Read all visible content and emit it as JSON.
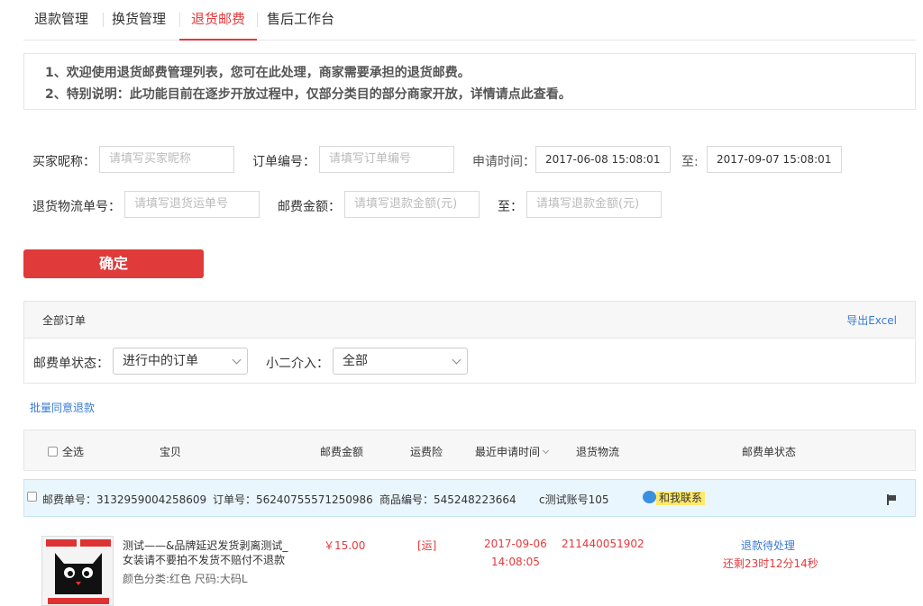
{
  "tabs": [
    "退款管理",
    "换货管理",
    "退货邮费",
    "售后工作台"
  ],
  "notice": [
    "1、欢迎使用退货邮费管理列表，您可在此处理，商家需要承担的退货邮费。",
    "2、特别说明：此功能目前在逐步开放过程中，仅部分类目的部分商家开放，详情请点此查看。"
  ],
  "filters": {
    "buyer_label": "买家昵称：",
    "buyer_placeholder": "请填写买家昵称",
    "order_label": "订单编号：",
    "order_placeholder": "请填写订单编号",
    "time_label": "申请时间：",
    "time_from": "2017-06-08 15:08:01",
    "to_label": "至:",
    "time_to": "2017-09-07 15:08:01",
    "logistics_label": "退货物流单号：",
    "logistics_placeholder": "请填写退货运单号",
    "amount_label": "邮费金额：",
    "amount_placeholder": "请填写退款金额(元)",
    "amount_to_label": "至：",
    "amount_to_placeholder": "请填写退款金额(元)"
  },
  "confirm_label": "确定",
  "panel": {
    "title": "全部订单",
    "export": "导出Excel",
    "status_label": "邮费单状态：",
    "status_value": "进行中的订单",
    "xiaoer_label": "小二介入：",
    "xiaoer_value": "全部"
  },
  "batch_label": "批量同意退款",
  "columns": {
    "select_all": "全选",
    "item": "宝贝",
    "amount": "邮费金额",
    "insurance": "运费险",
    "time": "最近申请时间",
    "logistics": "退货物流",
    "status": "邮费单状态"
  },
  "order": {
    "postage_no": "邮费单号：3132959004258609",
    "order_no": "订单号：56240755571250986",
    "product_no": "商品编号：545248223664",
    "account": "c测试账号105",
    "contact": "和我联系",
    "title_line1": "测试——&品牌延迟发货剥离测试_",
    "title_line2": "女装请不要拍不发货不赔付不退款",
    "sku": "颜色分类:红色  尺码:大码L",
    "amount": "￥15.00",
    "insurance": "[运]",
    "date": "2017-09-06",
    "time": "14:08:05",
    "logistics_no": "211440051902",
    "status": "退款待处理",
    "countdown": "还剩23时12分14秒"
  },
  "colors": {
    "accent": "#e4393c",
    "link": "#3a7bd5",
    "button": "#e03a3a"
  }
}
